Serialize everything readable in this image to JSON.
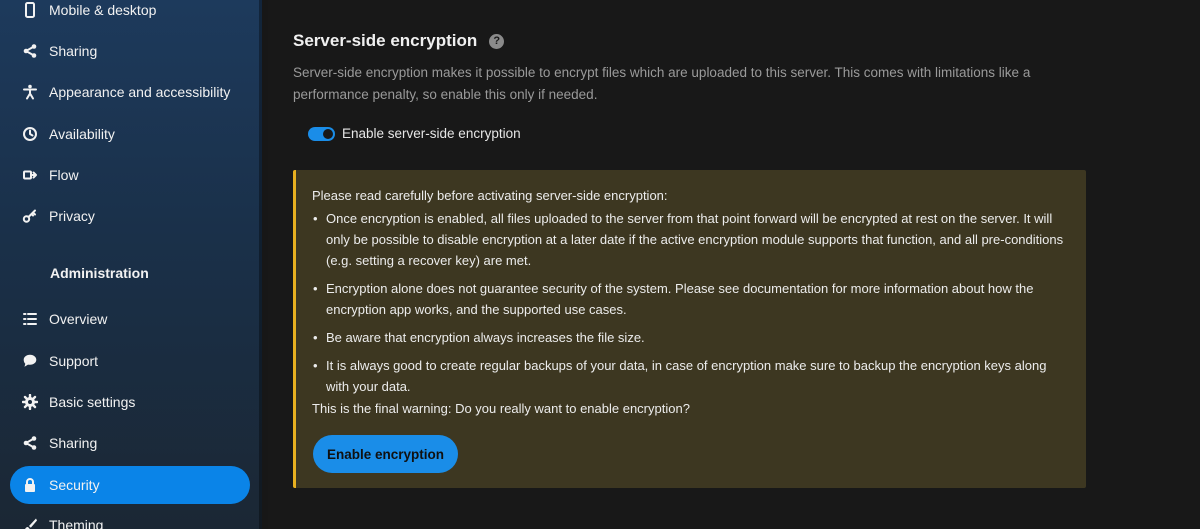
{
  "sidebar": {
    "items": [
      {
        "label": "Mobile & desktop",
        "icon": "phone-icon"
      },
      {
        "label": "Sharing",
        "icon": "share-icon"
      },
      {
        "label": "Appearance and accessibility",
        "icon": "accessibility-icon"
      },
      {
        "label": "Availability",
        "icon": "clock-icon"
      },
      {
        "label": "Flow",
        "icon": "flow-icon"
      },
      {
        "label": "Privacy",
        "icon": "key-icon"
      }
    ],
    "admin_heading": "Administration",
    "admin_items": [
      {
        "label": "Overview",
        "icon": "list-icon"
      },
      {
        "label": "Support",
        "icon": "chat-bubble-icon"
      },
      {
        "label": "Basic settings",
        "icon": "gear-icon"
      },
      {
        "label": "Sharing",
        "icon": "share-icon"
      },
      {
        "label": "Security",
        "icon": "lock-icon",
        "active": true
      },
      {
        "label": "Theming",
        "icon": "brush-icon"
      }
    ]
  },
  "main": {
    "title": "Server-side encryption",
    "help_icon": "?",
    "description": "Server-side encryption makes it possible to encrypt files which are uploaded to this server. This comes with limitations like a performance penalty, so enable this only if needed.",
    "toggle_label": "Enable server-side encryption",
    "toggle_on": true,
    "warning": {
      "intro": "Please read carefully before activating server-side encryption:",
      "bullets": [
        "Once encryption is enabled, all files uploaded to the server from that point forward will be encrypted at rest on the server. It will only be possible to disable encryption at a later date if the active encryption module supports that function, and all pre-conditions (e.g. setting a recover key) are met.",
        "Encryption alone does not guarantee security of the system. Please see documentation for more information about how the encryption app works, and the supported use cases.",
        "Be aware that encryption always increases the file size.",
        "It is always good to create regular backups of your data, in case of encryption make sure to backup the encryption keys along with your data."
      ],
      "final": "This is the final warning: Do you really want to enable encryption?",
      "button_label": "Enable encryption"
    }
  },
  "colors": {
    "accent": "#1a8de8",
    "warning_bg": "#3d3721",
    "warning_border": "#e8b020"
  }
}
